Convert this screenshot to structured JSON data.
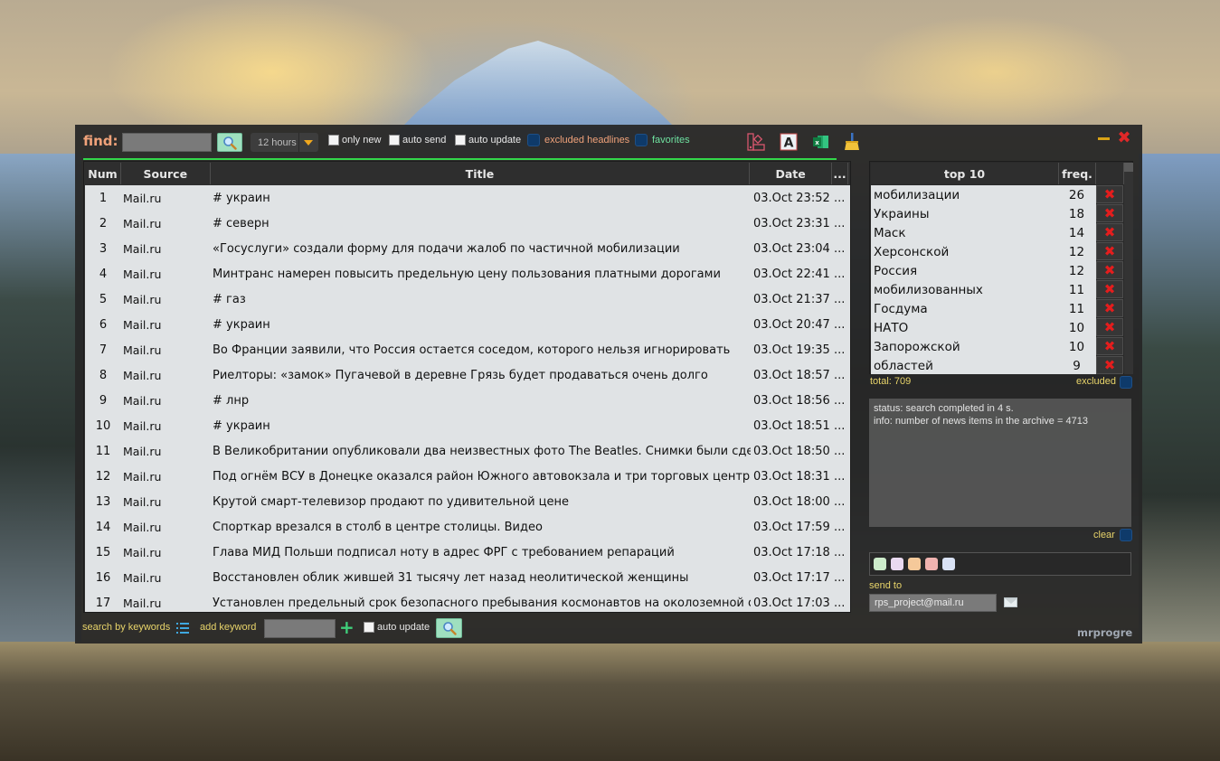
{
  "topbar": {
    "find_label": "find:",
    "find_value": "",
    "hours_select": "12 hours",
    "checkboxes": [
      {
        "label": "only new",
        "checked": false
      },
      {
        "label": "auto send",
        "checked": false
      },
      {
        "label": "auto update",
        "checked": false
      }
    ],
    "toggles": [
      {
        "label": "excluded headlines",
        "on": false
      },
      {
        "label": "favorites",
        "on": false
      }
    ],
    "tool_icons": [
      "color-palette-icon",
      "font-icon",
      "excel-icon",
      "broom-icon"
    ],
    "window_controls": [
      "minimize-icon",
      "close-icon"
    ]
  },
  "table": {
    "columns": [
      "Num",
      "Source",
      "Title",
      "Date",
      "..."
    ],
    "rows": [
      {
        "num": "1",
        "source": "Mail.ru",
        "title": "# украин",
        "date": "03.Oct 23:52",
        "more": "..."
      },
      {
        "num": "2",
        "source": "Mail.ru",
        "title": "# северн",
        "date": "03.Oct 23:31",
        "more": "..."
      },
      {
        "num": "3",
        "source": "Mail.ru",
        "title": "«Госуслуги» создали форму для подачи жалоб по частичной мобилизации",
        "date": "03.Oct 23:04",
        "more": "..."
      },
      {
        "num": "4",
        "source": "Mail.ru",
        "title": "Минтранс намерен повысить предельную цену пользования платными дорогами",
        "date": "03.Oct 22:41",
        "more": "..."
      },
      {
        "num": "5",
        "source": "Mail.ru",
        "title": "# газ",
        "date": "03.Oct 21:37",
        "more": "..."
      },
      {
        "num": "6",
        "source": "Mail.ru",
        "title": "# украин",
        "date": "03.Oct 20:47",
        "more": "..."
      },
      {
        "num": "7",
        "source": "Mail.ru",
        "title": "Во Франции заявили, что Россия остается соседом, которого нельзя игнорировать",
        "date": "03.Oct 19:35",
        "more": "..."
      },
      {
        "num": "8",
        "source": "Mail.ru",
        "title": "Риелторы: «замок» Пугачевой в деревне Грязь будет продаваться очень долго",
        "date": "03.Oct 18:57",
        "more": "..."
      },
      {
        "num": "9",
        "source": "Mail.ru",
        "title": "# лнр",
        "date": "03.Oct 18:56",
        "more": "..."
      },
      {
        "num": "10",
        "source": "Mail.ru",
        "title": "# украин",
        "date": "03.Oct 18:51",
        "more": "..."
      },
      {
        "num": "11",
        "source": "Mail.ru",
        "title": "В Великобритании опубликовали два неизвестных фото The Beatles. Снимки были сдела...",
        "date": "03.Oct 18:50",
        "more": "..."
      },
      {
        "num": "12",
        "source": "Mail.ru",
        "title": "Под огнём ВСУ в Донецке оказался район Южного автовокзала и три торговых центра",
        "date": "03.Oct 18:31",
        "more": "..."
      },
      {
        "num": "13",
        "source": "Mail.ru",
        "title": "Крутой смарт-телевизор продают по удивительной цене",
        "date": "03.Oct 18:00",
        "more": "..."
      },
      {
        "num": "14",
        "source": "Mail.ru",
        "title": "Спорткар врезался в столб в центре столицы. Видео",
        "date": "03.Oct 17:59",
        "more": "..."
      },
      {
        "num": "15",
        "source": "Mail.ru",
        "title": "Глава МИД Польши подписал ноту в адрес ФРГ с требованием репараций",
        "date": "03.Oct 17:18",
        "more": "..."
      },
      {
        "num": "16",
        "source": "Mail.ru",
        "title": "Восстановлен облик жившей 31 тысячу лет назад неолитической женщины",
        "date": "03.Oct 17:17",
        "more": "..."
      },
      {
        "num": "17",
        "source": "Mail.ru",
        "title": "Установлен предельный срок безопасного пребывания космонавтов на околоземной ор...",
        "date": "03.Oct 17:03",
        "more": "..."
      }
    ]
  },
  "bottombar": {
    "search_by_keywords": "search by keywords",
    "add_keyword": "add keyword",
    "keyword_value": "",
    "auto_update": "auto update"
  },
  "top10": {
    "columns": [
      "top 10",
      "freq."
    ],
    "rows": [
      {
        "word": "мобилизации",
        "freq": "26"
      },
      {
        "word": "Украины",
        "freq": "18"
      },
      {
        "word": "Маск",
        "freq": "14"
      },
      {
        "word": "Херсонской",
        "freq": "12"
      },
      {
        "word": "Россия",
        "freq": "12"
      },
      {
        "word": "мобилизованных",
        "freq": "11"
      },
      {
        "word": "Госдума",
        "freq": "11"
      },
      {
        "word": "НАТО",
        "freq": "10"
      },
      {
        "word": "Запорожской",
        "freq": "10"
      },
      {
        "word": "областей",
        "freq": "9"
      }
    ],
    "total": "total: 709",
    "excluded_label": "excluded"
  },
  "status": {
    "line1": "status: search completed in 4 s.",
    "line2": "info: number of news items in the archive = 4713",
    "clear_label": "clear"
  },
  "color_swatches": [
    "#cdeccb",
    "#e9d9f0",
    "#f5c99a",
    "#f0b3b0",
    "#d9e2f5"
  ],
  "send": {
    "label": "send to",
    "email": "rps_project@mail.ru"
  },
  "brand": "mrprogre",
  "colors": {
    "accent_orange": "#f0a27a",
    "accent_green": "#33d84a",
    "label_yellow": "#e8d46a",
    "delete_red": "#e51d1d"
  }
}
